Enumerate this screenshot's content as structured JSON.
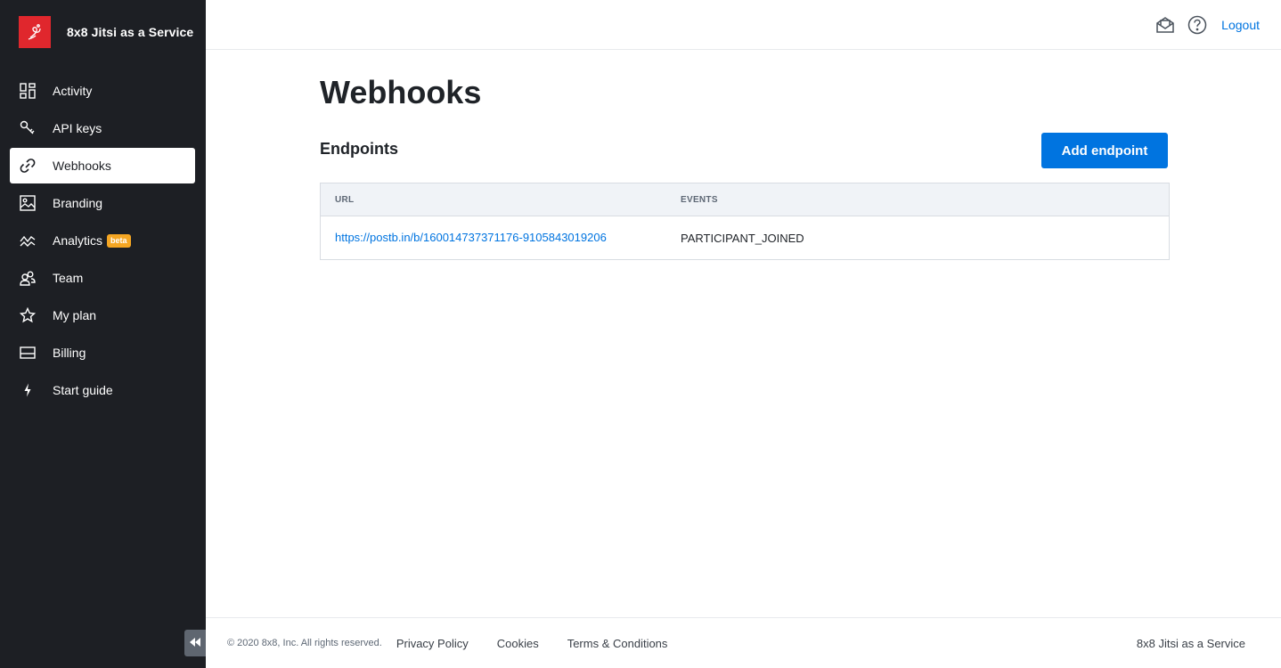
{
  "brand": {
    "name": "8x8 Jitsi as a Service",
    "logo_color": "#e0272d"
  },
  "sidebar": {
    "items": [
      {
        "label": "Activity",
        "icon": "dashboard-icon"
      },
      {
        "label": "API keys",
        "icon": "key-icon"
      },
      {
        "label": "Webhooks",
        "icon": "webhook-icon",
        "active": true
      },
      {
        "label": "Branding",
        "icon": "image-icon"
      },
      {
        "label": "Analytics",
        "icon": "analytics-icon",
        "badge": "beta"
      },
      {
        "label": "Team",
        "icon": "team-icon"
      },
      {
        "label": "My plan",
        "icon": "star-icon"
      },
      {
        "label": "Billing",
        "icon": "card-icon"
      },
      {
        "label": "Start guide",
        "icon": "bolt-icon"
      }
    ]
  },
  "topbar": {
    "logout": "Logout"
  },
  "page": {
    "title": "Webhooks",
    "section_title": "Endpoints",
    "add_button": "Add endpoint"
  },
  "table": {
    "headers": {
      "url": "URL",
      "events": "EVENTS"
    },
    "rows": [
      {
        "url": "https://postb.in/b/160014737371176-9105843019206",
        "events": "PARTICIPANT_JOINED"
      }
    ]
  },
  "footer": {
    "copyright": "© 2020 8x8, Inc. All rights reserved.",
    "links": [
      "Privacy Policy",
      "Cookies",
      "Terms & Conditions"
    ],
    "brand": "8x8 Jitsi as a Service"
  },
  "colors": {
    "accent": "#0074e0",
    "sidebar_bg": "#1d1f24",
    "badge": "#f5a623"
  }
}
